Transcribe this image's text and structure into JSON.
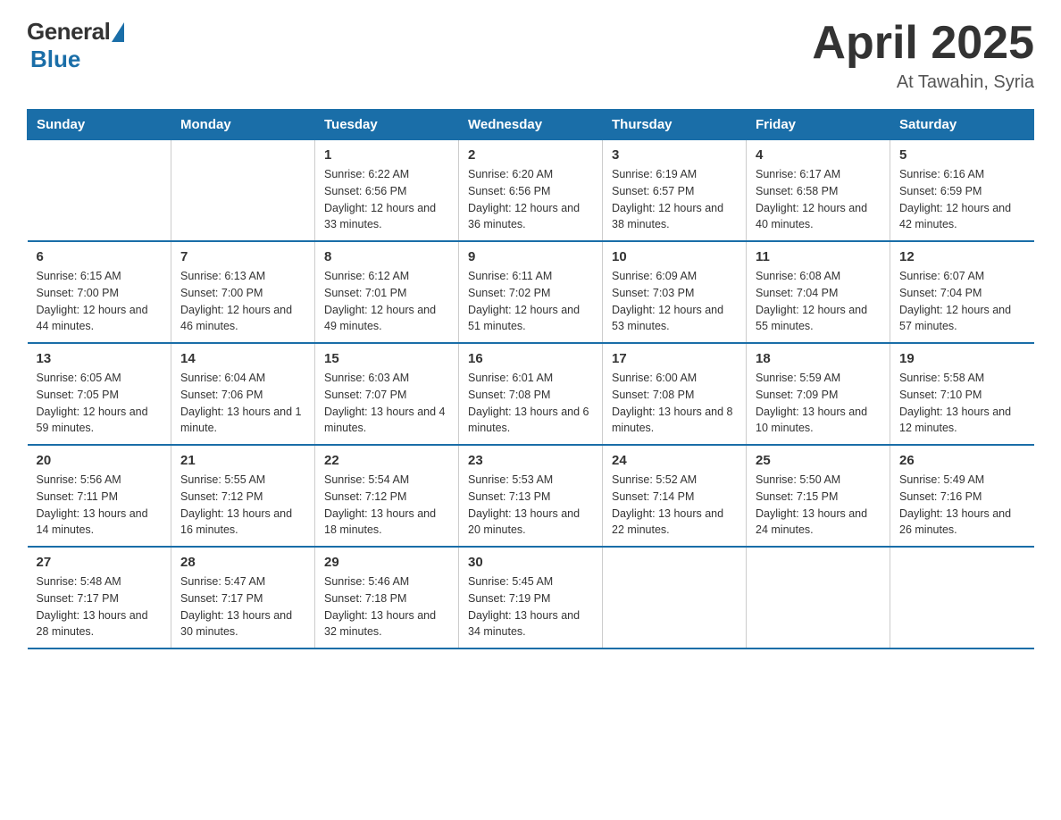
{
  "logo": {
    "general": "General",
    "blue": "Blue"
  },
  "title": "April 2025",
  "location": "At Tawahin, Syria",
  "days_of_week": [
    "Sunday",
    "Monday",
    "Tuesday",
    "Wednesday",
    "Thursday",
    "Friday",
    "Saturday"
  ],
  "weeks": [
    [
      {
        "day": "",
        "sunrise": "",
        "sunset": "",
        "daylight": ""
      },
      {
        "day": "",
        "sunrise": "",
        "sunset": "",
        "daylight": ""
      },
      {
        "day": "1",
        "sunrise": "Sunrise: 6:22 AM",
        "sunset": "Sunset: 6:56 PM",
        "daylight": "Daylight: 12 hours and 33 minutes."
      },
      {
        "day": "2",
        "sunrise": "Sunrise: 6:20 AM",
        "sunset": "Sunset: 6:56 PM",
        "daylight": "Daylight: 12 hours and 36 minutes."
      },
      {
        "day": "3",
        "sunrise": "Sunrise: 6:19 AM",
        "sunset": "Sunset: 6:57 PM",
        "daylight": "Daylight: 12 hours and 38 minutes."
      },
      {
        "day": "4",
        "sunrise": "Sunrise: 6:17 AM",
        "sunset": "Sunset: 6:58 PM",
        "daylight": "Daylight: 12 hours and 40 minutes."
      },
      {
        "day": "5",
        "sunrise": "Sunrise: 6:16 AM",
        "sunset": "Sunset: 6:59 PM",
        "daylight": "Daylight: 12 hours and 42 minutes."
      }
    ],
    [
      {
        "day": "6",
        "sunrise": "Sunrise: 6:15 AM",
        "sunset": "Sunset: 7:00 PM",
        "daylight": "Daylight: 12 hours and 44 minutes."
      },
      {
        "day": "7",
        "sunrise": "Sunrise: 6:13 AM",
        "sunset": "Sunset: 7:00 PM",
        "daylight": "Daylight: 12 hours and 46 minutes."
      },
      {
        "day": "8",
        "sunrise": "Sunrise: 6:12 AM",
        "sunset": "Sunset: 7:01 PM",
        "daylight": "Daylight: 12 hours and 49 minutes."
      },
      {
        "day": "9",
        "sunrise": "Sunrise: 6:11 AM",
        "sunset": "Sunset: 7:02 PM",
        "daylight": "Daylight: 12 hours and 51 minutes."
      },
      {
        "day": "10",
        "sunrise": "Sunrise: 6:09 AM",
        "sunset": "Sunset: 7:03 PM",
        "daylight": "Daylight: 12 hours and 53 minutes."
      },
      {
        "day": "11",
        "sunrise": "Sunrise: 6:08 AM",
        "sunset": "Sunset: 7:04 PM",
        "daylight": "Daylight: 12 hours and 55 minutes."
      },
      {
        "day": "12",
        "sunrise": "Sunrise: 6:07 AM",
        "sunset": "Sunset: 7:04 PM",
        "daylight": "Daylight: 12 hours and 57 minutes."
      }
    ],
    [
      {
        "day": "13",
        "sunrise": "Sunrise: 6:05 AM",
        "sunset": "Sunset: 7:05 PM",
        "daylight": "Daylight: 12 hours and 59 minutes."
      },
      {
        "day": "14",
        "sunrise": "Sunrise: 6:04 AM",
        "sunset": "Sunset: 7:06 PM",
        "daylight": "Daylight: 13 hours and 1 minute."
      },
      {
        "day": "15",
        "sunrise": "Sunrise: 6:03 AM",
        "sunset": "Sunset: 7:07 PM",
        "daylight": "Daylight: 13 hours and 4 minutes."
      },
      {
        "day": "16",
        "sunrise": "Sunrise: 6:01 AM",
        "sunset": "Sunset: 7:08 PM",
        "daylight": "Daylight: 13 hours and 6 minutes."
      },
      {
        "day": "17",
        "sunrise": "Sunrise: 6:00 AM",
        "sunset": "Sunset: 7:08 PM",
        "daylight": "Daylight: 13 hours and 8 minutes."
      },
      {
        "day": "18",
        "sunrise": "Sunrise: 5:59 AM",
        "sunset": "Sunset: 7:09 PM",
        "daylight": "Daylight: 13 hours and 10 minutes."
      },
      {
        "day": "19",
        "sunrise": "Sunrise: 5:58 AM",
        "sunset": "Sunset: 7:10 PM",
        "daylight": "Daylight: 13 hours and 12 minutes."
      }
    ],
    [
      {
        "day": "20",
        "sunrise": "Sunrise: 5:56 AM",
        "sunset": "Sunset: 7:11 PM",
        "daylight": "Daylight: 13 hours and 14 minutes."
      },
      {
        "day": "21",
        "sunrise": "Sunrise: 5:55 AM",
        "sunset": "Sunset: 7:12 PM",
        "daylight": "Daylight: 13 hours and 16 minutes."
      },
      {
        "day": "22",
        "sunrise": "Sunrise: 5:54 AM",
        "sunset": "Sunset: 7:12 PM",
        "daylight": "Daylight: 13 hours and 18 minutes."
      },
      {
        "day": "23",
        "sunrise": "Sunrise: 5:53 AM",
        "sunset": "Sunset: 7:13 PM",
        "daylight": "Daylight: 13 hours and 20 minutes."
      },
      {
        "day": "24",
        "sunrise": "Sunrise: 5:52 AM",
        "sunset": "Sunset: 7:14 PM",
        "daylight": "Daylight: 13 hours and 22 minutes."
      },
      {
        "day": "25",
        "sunrise": "Sunrise: 5:50 AM",
        "sunset": "Sunset: 7:15 PM",
        "daylight": "Daylight: 13 hours and 24 minutes."
      },
      {
        "day": "26",
        "sunrise": "Sunrise: 5:49 AM",
        "sunset": "Sunset: 7:16 PM",
        "daylight": "Daylight: 13 hours and 26 minutes."
      }
    ],
    [
      {
        "day": "27",
        "sunrise": "Sunrise: 5:48 AM",
        "sunset": "Sunset: 7:17 PM",
        "daylight": "Daylight: 13 hours and 28 minutes."
      },
      {
        "day": "28",
        "sunrise": "Sunrise: 5:47 AM",
        "sunset": "Sunset: 7:17 PM",
        "daylight": "Daylight: 13 hours and 30 minutes."
      },
      {
        "day": "29",
        "sunrise": "Sunrise: 5:46 AM",
        "sunset": "Sunset: 7:18 PM",
        "daylight": "Daylight: 13 hours and 32 minutes."
      },
      {
        "day": "30",
        "sunrise": "Sunrise: 5:45 AM",
        "sunset": "Sunset: 7:19 PM",
        "daylight": "Daylight: 13 hours and 34 minutes."
      },
      {
        "day": "",
        "sunrise": "",
        "sunset": "",
        "daylight": ""
      },
      {
        "day": "",
        "sunrise": "",
        "sunset": "",
        "daylight": ""
      },
      {
        "day": "",
        "sunrise": "",
        "sunset": "",
        "daylight": ""
      }
    ]
  ]
}
